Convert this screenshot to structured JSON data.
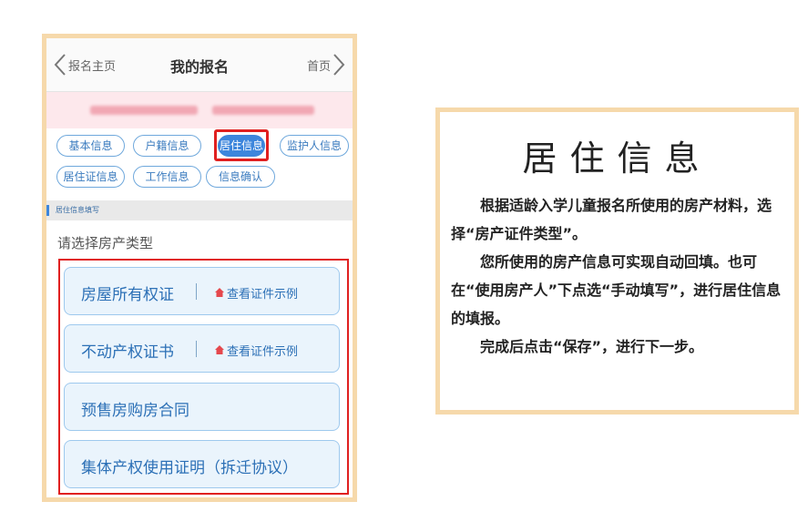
{
  "header": {
    "back_label": "报名主页",
    "title": "我的报名",
    "home_label": "首页"
  },
  "tabs": [
    {
      "label": "基本信息",
      "active": false
    },
    {
      "label": "户籍信息",
      "active": false
    },
    {
      "label": "居住信息",
      "active": true
    },
    {
      "label": "监护人信息",
      "active": false
    },
    {
      "label": "居住证信息",
      "active": false
    },
    {
      "label": "工作信息",
      "active": false
    },
    {
      "label": "信息确认",
      "active": false
    }
  ],
  "section": {
    "label": "居住信息填写",
    "prompt": "请选择房产类型"
  },
  "options": [
    {
      "label": "房屋所有权证",
      "example_label": "查看证件示例"
    },
    {
      "label": "不动产权证书",
      "example_label": "查看证件示例"
    },
    {
      "label": "预售房购房合同"
    },
    {
      "label": "集体产权使用证明（拆迁协议）"
    }
  ],
  "info": {
    "title": "居住信息",
    "paragraphs": [
      "根据适龄入学儿童报名所使用的房产材料，选择“房产证件类型”。",
      "您所使用的房产信息可实现自动回填。也可在“使用房产人”下点选“手动填写”，进行居住信息的填报。",
      "完成后点击“保存”，进行下一步。"
    ]
  },
  "colors": {
    "accent": "#3d86dc",
    "highlight": "#e02020",
    "frame": "#f6d9ab"
  }
}
